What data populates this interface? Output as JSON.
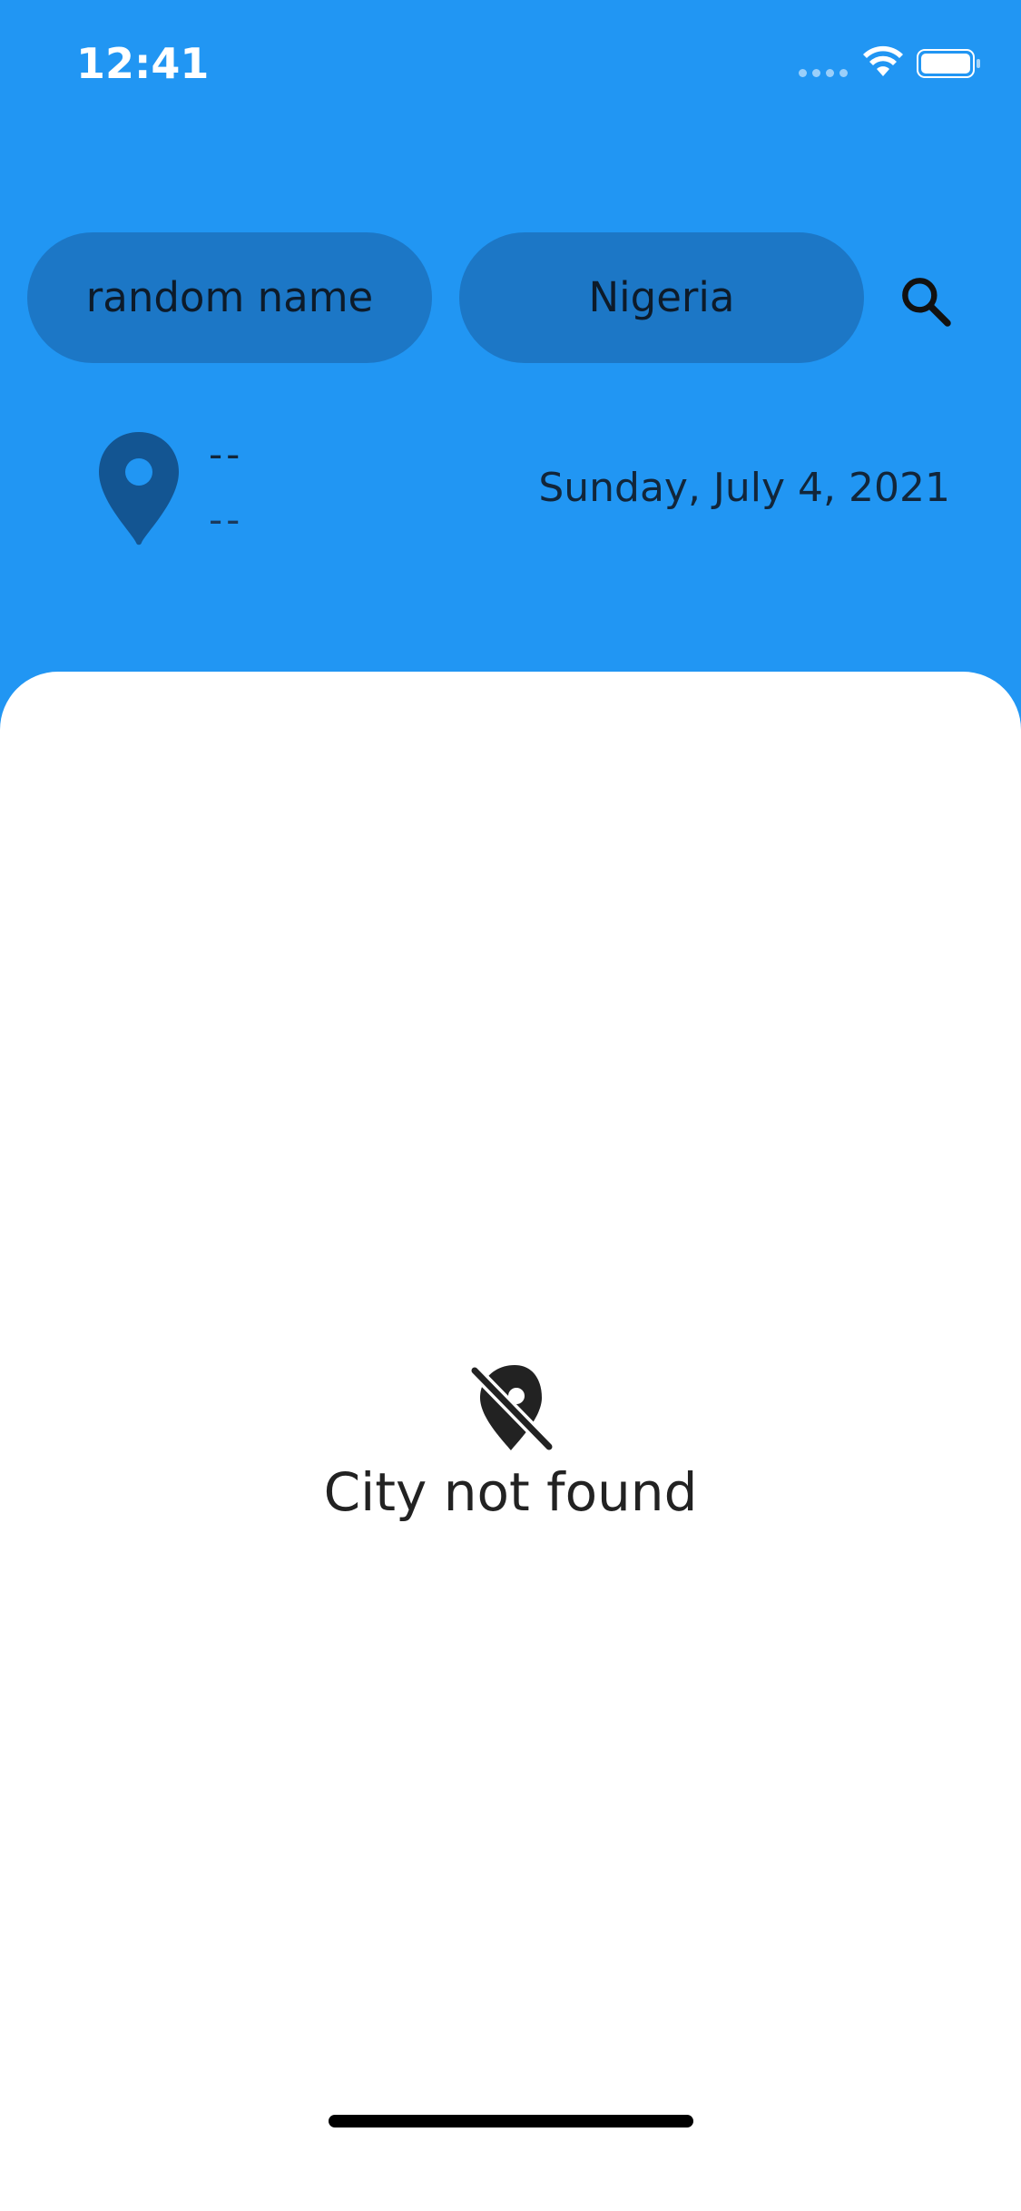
{
  "status_bar": {
    "time": "12:41"
  },
  "search": {
    "name_value": "random name",
    "country_value": "Nigeria"
  },
  "location": {
    "city": "--",
    "country": "--",
    "date": "Sunday, July 4, 2021"
  },
  "empty_state": {
    "message": "City not found"
  },
  "colors": {
    "header_bg": "#2196f3",
    "pill_bg": "#1c77c6",
    "pin_color": "#135592",
    "card_bg": "#ffffff",
    "text_dark": "#222222"
  },
  "icons": {
    "wifi": "wifi-icon",
    "battery": "battery-icon",
    "search": "search-icon",
    "pin": "location-pin-icon",
    "location_off": "location-off-icon"
  }
}
